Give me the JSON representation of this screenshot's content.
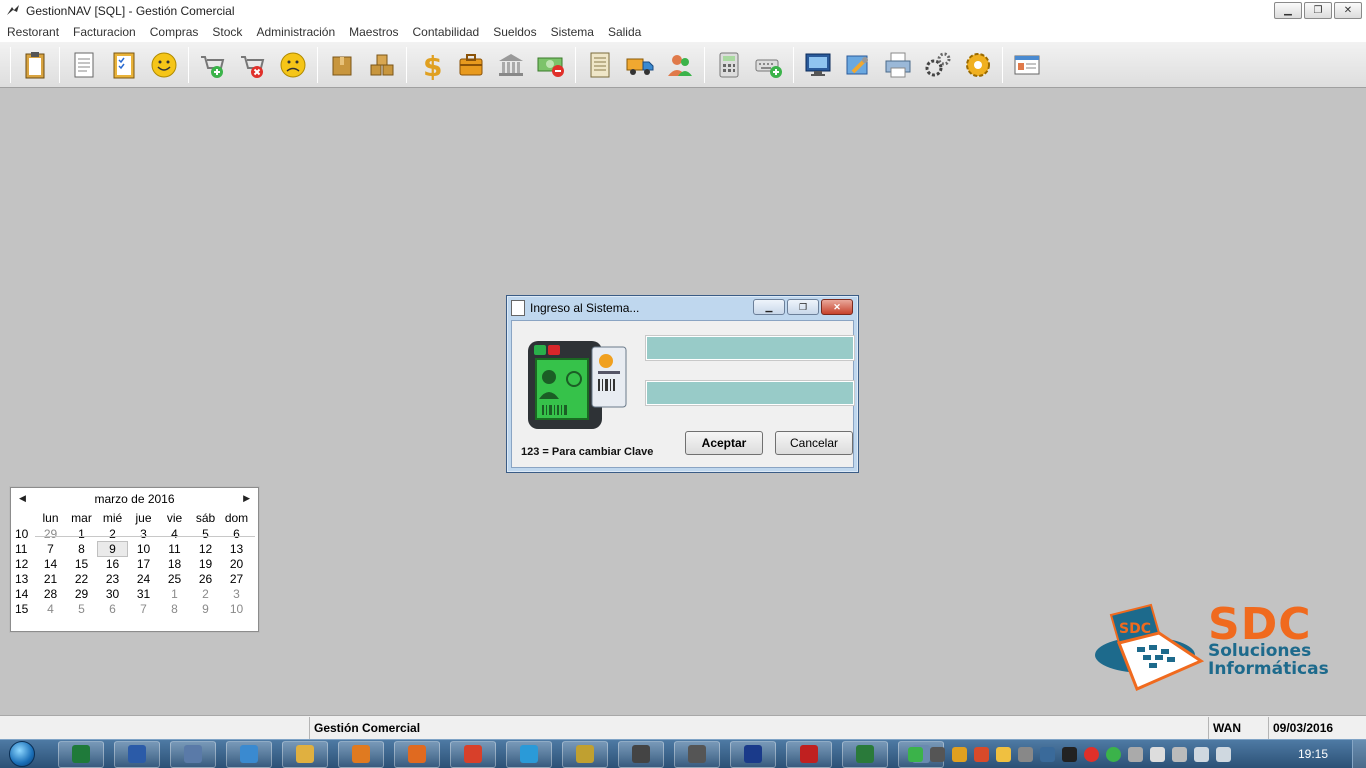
{
  "window": {
    "title": "GestionNAV [SQL] - Gestión Comercial",
    "minimize_label": "▁",
    "maximize_label": "❐",
    "close_label": "✕"
  },
  "menu": [
    "Restorant",
    "Facturacion",
    "Compras",
    "Stock",
    "Administración",
    "Maestros",
    "Contabilidad",
    "Sueldos",
    "Sistema",
    "Salida"
  ],
  "toolbar": {
    "buttons": [
      "clipboard-icon",
      "document-icon",
      "checklist-icon",
      "smiley-icon",
      "cart-add-icon",
      "cart-remove-icon",
      "sad-face-icon",
      "box-icon",
      "boxes-icon",
      "dollar-icon",
      "briefcase-icon",
      "bank-icon",
      "cash-remove-icon",
      "ledger-icon",
      "truck-icon",
      "users-icon",
      "calculator-icon",
      "keyboard-add-icon",
      "monitor-icon",
      "tools-icon",
      "printer-icon",
      "gears-icon",
      "settings-gear-icon",
      "card-icon"
    ]
  },
  "login_dialog": {
    "title": "Ingreso al Sistema...",
    "user_value": "",
    "password_value": "",
    "hint": "123 = Para cambiar Clave",
    "accept_label": "Aceptar",
    "cancel_label": "Cancelar"
  },
  "calendar": {
    "month_label": "marzo de 2016",
    "prev": "◀",
    "next": "▶",
    "weekdays": [
      "lun",
      "mar",
      "mié",
      "jue",
      "vie",
      "sáb",
      "dom"
    ],
    "weeks": [
      {
        "wk": "10",
        "days": [
          "29",
          "1",
          "2",
          "3",
          "4",
          "5",
          "6"
        ]
      },
      {
        "wk": "11",
        "days": [
          "7",
          "8",
          "9",
          "10",
          "11",
          "12",
          "13"
        ]
      },
      {
        "wk": "12",
        "days": [
          "14",
          "15",
          "16",
          "17",
          "18",
          "19",
          "20"
        ]
      },
      {
        "wk": "13",
        "days": [
          "21",
          "22",
          "23",
          "24",
          "25",
          "26",
          "27"
        ]
      },
      {
        "wk": "14",
        "days": [
          "28",
          "29",
          "30",
          "31",
          "1",
          "2",
          "3"
        ]
      },
      {
        "wk": "15",
        "days": [
          "4",
          "5",
          "6",
          "7",
          "8",
          "9",
          "10"
        ]
      }
    ],
    "today": "9"
  },
  "logo": {
    "word": "SDC",
    "line1": "Soluciones",
    "line2": "Informáticas",
    "badge": "SDC"
  },
  "statusbar": {
    "module": "Gestión Comercial",
    "connection": "WAN",
    "date": "09/03/2016"
  },
  "taskbar": {
    "apps": [
      "excel-icon",
      "word-icon",
      "pen-icon",
      "ie-icon",
      "folder-icon",
      "media-icon",
      "firefox-icon",
      "chrome-icon",
      "skype-icon",
      "remote-icon",
      "window-icon",
      "usb-icon",
      "db-icon",
      "filezilla-icon",
      "app-icon",
      "vb-icon"
    ],
    "time": "19:15"
  },
  "colors": {
    "accent_orange": "#f06a1e",
    "accent_blue": "#1d6a8c",
    "field_fill": "#98cbc8"
  }
}
